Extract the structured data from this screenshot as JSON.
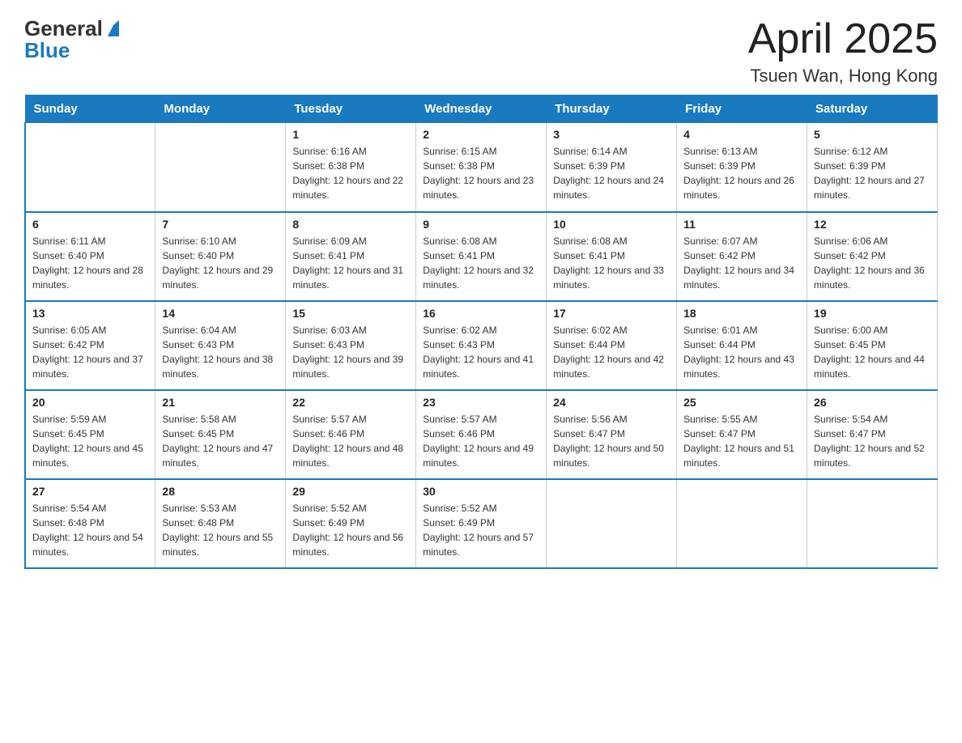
{
  "header": {
    "logo_general": "General",
    "logo_blue": "Blue",
    "month_year": "April 2025",
    "location": "Tsuen Wan, Hong Kong"
  },
  "days_of_week": [
    "Sunday",
    "Monday",
    "Tuesday",
    "Wednesday",
    "Thursday",
    "Friday",
    "Saturday"
  ],
  "weeks": [
    [
      {
        "day": "",
        "sunrise": "",
        "sunset": "",
        "daylight": ""
      },
      {
        "day": "",
        "sunrise": "",
        "sunset": "",
        "daylight": ""
      },
      {
        "day": "1",
        "sunrise": "Sunrise: 6:16 AM",
        "sunset": "Sunset: 6:38 PM",
        "daylight": "Daylight: 12 hours and 22 minutes."
      },
      {
        "day": "2",
        "sunrise": "Sunrise: 6:15 AM",
        "sunset": "Sunset: 6:38 PM",
        "daylight": "Daylight: 12 hours and 23 minutes."
      },
      {
        "day": "3",
        "sunrise": "Sunrise: 6:14 AM",
        "sunset": "Sunset: 6:39 PM",
        "daylight": "Daylight: 12 hours and 24 minutes."
      },
      {
        "day": "4",
        "sunrise": "Sunrise: 6:13 AM",
        "sunset": "Sunset: 6:39 PM",
        "daylight": "Daylight: 12 hours and 26 minutes."
      },
      {
        "day": "5",
        "sunrise": "Sunrise: 6:12 AM",
        "sunset": "Sunset: 6:39 PM",
        "daylight": "Daylight: 12 hours and 27 minutes."
      }
    ],
    [
      {
        "day": "6",
        "sunrise": "Sunrise: 6:11 AM",
        "sunset": "Sunset: 6:40 PM",
        "daylight": "Daylight: 12 hours and 28 minutes."
      },
      {
        "day": "7",
        "sunrise": "Sunrise: 6:10 AM",
        "sunset": "Sunset: 6:40 PM",
        "daylight": "Daylight: 12 hours and 29 minutes."
      },
      {
        "day": "8",
        "sunrise": "Sunrise: 6:09 AM",
        "sunset": "Sunset: 6:41 PM",
        "daylight": "Daylight: 12 hours and 31 minutes."
      },
      {
        "day": "9",
        "sunrise": "Sunrise: 6:08 AM",
        "sunset": "Sunset: 6:41 PM",
        "daylight": "Daylight: 12 hours and 32 minutes."
      },
      {
        "day": "10",
        "sunrise": "Sunrise: 6:08 AM",
        "sunset": "Sunset: 6:41 PM",
        "daylight": "Daylight: 12 hours and 33 minutes."
      },
      {
        "day": "11",
        "sunrise": "Sunrise: 6:07 AM",
        "sunset": "Sunset: 6:42 PM",
        "daylight": "Daylight: 12 hours and 34 minutes."
      },
      {
        "day": "12",
        "sunrise": "Sunrise: 6:06 AM",
        "sunset": "Sunset: 6:42 PM",
        "daylight": "Daylight: 12 hours and 36 minutes."
      }
    ],
    [
      {
        "day": "13",
        "sunrise": "Sunrise: 6:05 AM",
        "sunset": "Sunset: 6:42 PM",
        "daylight": "Daylight: 12 hours and 37 minutes."
      },
      {
        "day": "14",
        "sunrise": "Sunrise: 6:04 AM",
        "sunset": "Sunset: 6:43 PM",
        "daylight": "Daylight: 12 hours and 38 minutes."
      },
      {
        "day": "15",
        "sunrise": "Sunrise: 6:03 AM",
        "sunset": "Sunset: 6:43 PM",
        "daylight": "Daylight: 12 hours and 39 minutes."
      },
      {
        "day": "16",
        "sunrise": "Sunrise: 6:02 AM",
        "sunset": "Sunset: 6:43 PM",
        "daylight": "Daylight: 12 hours and 41 minutes."
      },
      {
        "day": "17",
        "sunrise": "Sunrise: 6:02 AM",
        "sunset": "Sunset: 6:44 PM",
        "daylight": "Daylight: 12 hours and 42 minutes."
      },
      {
        "day": "18",
        "sunrise": "Sunrise: 6:01 AM",
        "sunset": "Sunset: 6:44 PM",
        "daylight": "Daylight: 12 hours and 43 minutes."
      },
      {
        "day": "19",
        "sunrise": "Sunrise: 6:00 AM",
        "sunset": "Sunset: 6:45 PM",
        "daylight": "Daylight: 12 hours and 44 minutes."
      }
    ],
    [
      {
        "day": "20",
        "sunrise": "Sunrise: 5:59 AM",
        "sunset": "Sunset: 6:45 PM",
        "daylight": "Daylight: 12 hours and 45 minutes."
      },
      {
        "day": "21",
        "sunrise": "Sunrise: 5:58 AM",
        "sunset": "Sunset: 6:45 PM",
        "daylight": "Daylight: 12 hours and 47 minutes."
      },
      {
        "day": "22",
        "sunrise": "Sunrise: 5:57 AM",
        "sunset": "Sunset: 6:46 PM",
        "daylight": "Daylight: 12 hours and 48 minutes."
      },
      {
        "day": "23",
        "sunrise": "Sunrise: 5:57 AM",
        "sunset": "Sunset: 6:46 PM",
        "daylight": "Daylight: 12 hours and 49 minutes."
      },
      {
        "day": "24",
        "sunrise": "Sunrise: 5:56 AM",
        "sunset": "Sunset: 6:47 PM",
        "daylight": "Daylight: 12 hours and 50 minutes."
      },
      {
        "day": "25",
        "sunrise": "Sunrise: 5:55 AM",
        "sunset": "Sunset: 6:47 PM",
        "daylight": "Daylight: 12 hours and 51 minutes."
      },
      {
        "day": "26",
        "sunrise": "Sunrise: 5:54 AM",
        "sunset": "Sunset: 6:47 PM",
        "daylight": "Daylight: 12 hours and 52 minutes."
      }
    ],
    [
      {
        "day": "27",
        "sunrise": "Sunrise: 5:54 AM",
        "sunset": "Sunset: 6:48 PM",
        "daylight": "Daylight: 12 hours and 54 minutes."
      },
      {
        "day": "28",
        "sunrise": "Sunrise: 5:53 AM",
        "sunset": "Sunset: 6:48 PM",
        "daylight": "Daylight: 12 hours and 55 minutes."
      },
      {
        "day": "29",
        "sunrise": "Sunrise: 5:52 AM",
        "sunset": "Sunset: 6:49 PM",
        "daylight": "Daylight: 12 hours and 56 minutes."
      },
      {
        "day": "30",
        "sunrise": "Sunrise: 5:52 AM",
        "sunset": "Sunset: 6:49 PM",
        "daylight": "Daylight: 12 hours and 57 minutes."
      },
      {
        "day": "",
        "sunrise": "",
        "sunset": "",
        "daylight": ""
      },
      {
        "day": "",
        "sunrise": "",
        "sunset": "",
        "daylight": ""
      },
      {
        "day": "",
        "sunrise": "",
        "sunset": "",
        "daylight": ""
      }
    ]
  ],
  "colors": {
    "header_bg": "#1a7abf",
    "header_text": "#ffffff",
    "border": "#1a7abf",
    "text": "#222222",
    "logo_blue": "#1a7abf",
    "logo_dark": "#333333"
  }
}
